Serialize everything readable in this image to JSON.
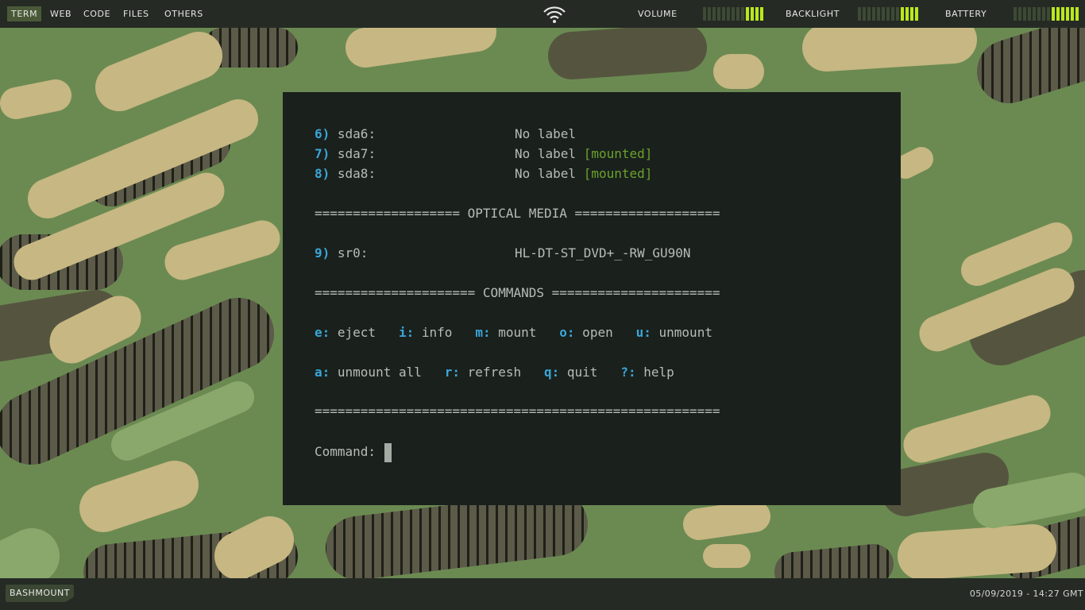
{
  "topbar": {
    "workspaces": [
      "TERM",
      "WEB",
      "CODE",
      "FILES",
      "OTHERS"
    ],
    "active_workspace": "TERM",
    "volume_label": "VOLUME",
    "volume_level": 0.3,
    "backlight_label": "BACKLIGHT",
    "backlight_level": 0.3,
    "battery_label": "BATTERY",
    "battery_level": 0.4,
    "meter_on_color": "#b9e81c",
    "icons": {
      "wifi": "wifi-icon"
    }
  },
  "terminal": {
    "devices": [
      {
        "num": "6)",
        "name": "sda6:",
        "label": "No label",
        "status": ""
      },
      {
        "num": "7)",
        "name": "sda7:",
        "label": "No label",
        "status": "[mounted]"
      },
      {
        "num": "8)",
        "name": "sda8:",
        "label": "No label",
        "status": "[mounted]"
      }
    ],
    "optical_header": "=================== OPTICAL MEDIA ===================",
    "optical": {
      "num": "9)",
      "name": "sr0:",
      "label": "HL-DT-ST_DVD+_-RW_GU90N"
    },
    "commands_header": "===================== COMMANDS ======================",
    "commands_row1": [
      {
        "key": "e:",
        "desc": " eject"
      },
      {
        "key": "i:",
        "desc": " info"
      },
      {
        "key": "m:",
        "desc": " mount"
      },
      {
        "key": "o:",
        "desc": " open"
      },
      {
        "key": "u:",
        "desc": " unmount"
      }
    ],
    "commands_row2": [
      {
        "key": "a:",
        "desc": " unmount all"
      },
      {
        "key": "r:",
        "desc": " refresh"
      },
      {
        "key": "q:",
        "desc": " quit"
      },
      {
        "key": "?:",
        "desc": " help"
      }
    ],
    "footer_rule": "=====================================================",
    "prompt": "Command: "
  },
  "bottombar": {
    "task": "BASHMOUNT",
    "clock": "05/09/2019 - 14:27 GMT"
  }
}
